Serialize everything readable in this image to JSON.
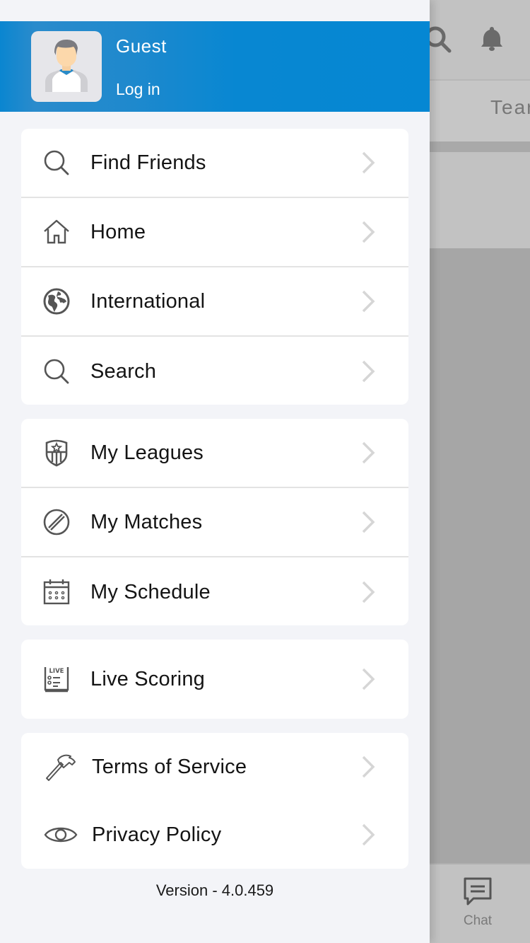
{
  "background_app": {
    "tab_partial_label": "Tear",
    "bottom_nav": {
      "chat_label": "Chat"
    },
    "icons": [
      "search-icon",
      "bell-icon",
      "chat-icon"
    ]
  },
  "drawer": {
    "header": {
      "user_name": "Guest",
      "login_label": "Log in",
      "accent_color": "#0587d3"
    },
    "groups": [
      {
        "items": [
          {
            "label": "Find Friends",
            "icon": "search-icon"
          },
          {
            "label": "Home",
            "icon": "home-icon"
          },
          {
            "label": "International",
            "icon": "globe-icon"
          },
          {
            "label": "Search",
            "icon": "search-icon"
          }
        ]
      },
      {
        "items": [
          {
            "label": "My Leagues",
            "icon": "league-shield-icon"
          },
          {
            "label": "My Matches",
            "icon": "cricket-ball-icon"
          },
          {
            "label": "My Schedule",
            "icon": "calendar-icon"
          }
        ]
      },
      {
        "items": [
          {
            "label": "Live Scoring",
            "icon": "live-scoreboard-icon"
          }
        ]
      },
      {
        "items": [
          {
            "label": "Terms of Service",
            "icon": "hammer-icon"
          },
          {
            "label": "Privacy Policy",
            "icon": "eye-icon"
          }
        ]
      }
    ],
    "version_text": "Version - 4.0.459"
  }
}
